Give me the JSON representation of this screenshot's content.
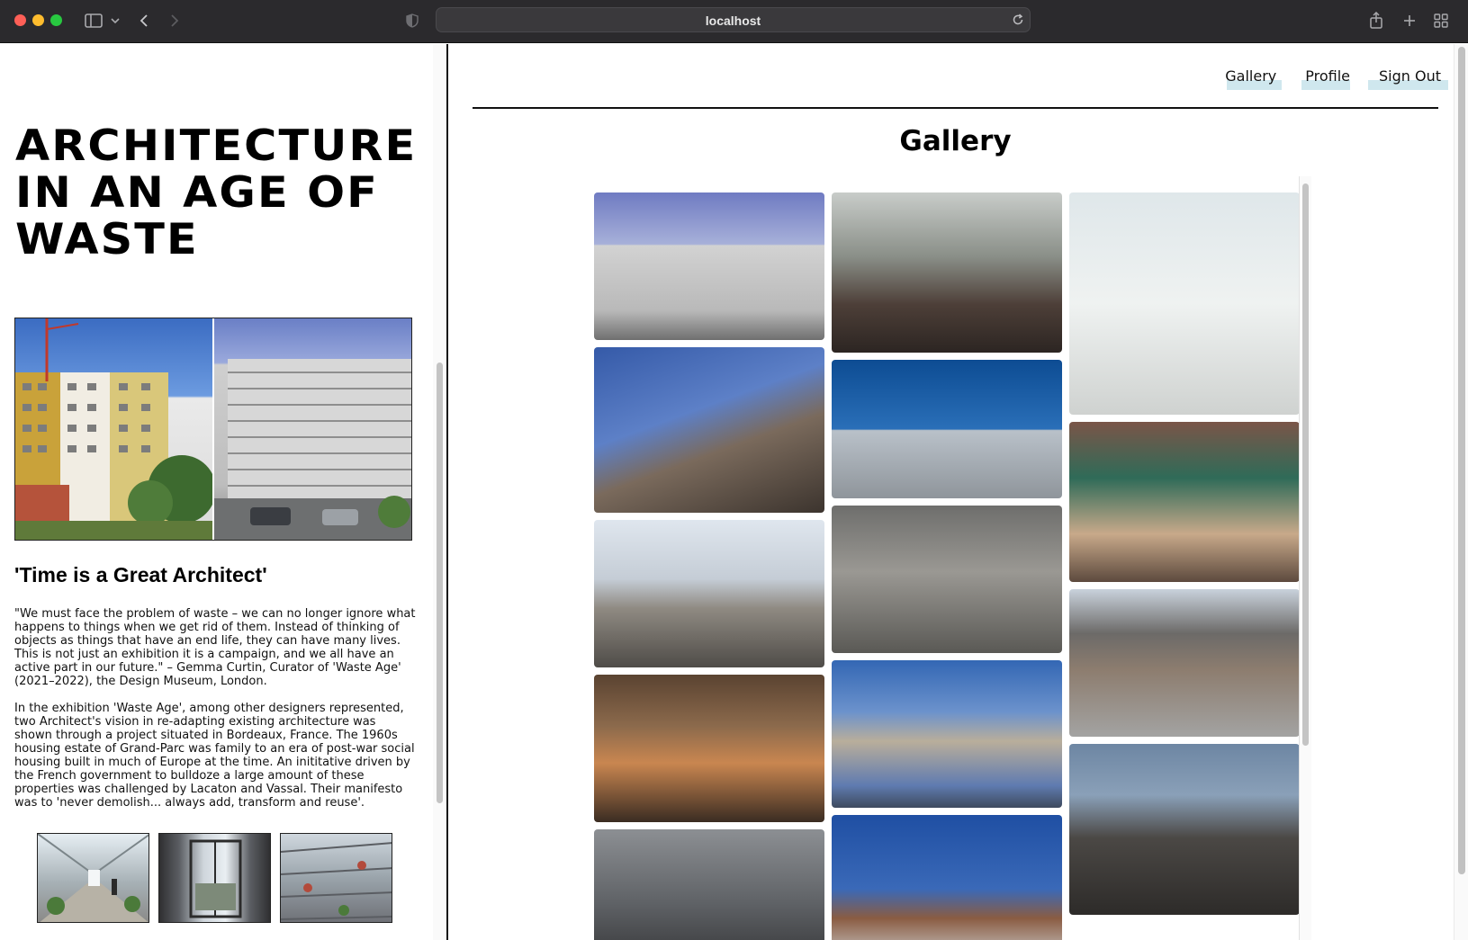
{
  "browser": {
    "url": "localhost"
  },
  "left": {
    "title_lines": [
      "ARCHITECTURE",
      "IN AN AGE OF",
      "WASTE"
    ],
    "hero_image_alt": "Grand-Parc housing before and after transformation",
    "quote_heading": "'Time is a Great Architect'",
    "paragraph1": "\"We must face the problem of waste – we can no longer ignore what happens to things when we get rid of them. Instead of thinking of objects as things that have an end life, they can have many lives. This is not just an exhibition it is a campaign, and we all have an active part in our future.\" – Gemma Curtin, Curator of 'Waste Age' (2021–2022), the Design Museum, London.",
    "paragraph2": "In the exhibition 'Waste Age', among other designers represented, two Architect's vision in re-adapting existing architecture was shown through a project situated in Bordeaux, France. The 1960s housing estate of Grand-Parc was family to an era of post-war social housing built in much of Europe at the time. An inititative driven by the French government to bulldoze a large amount of these properties was challenged by Lacaton and Vassal. Their manifesto was to 'never demolish... always add, transform and reuse'."
  },
  "nav": {
    "gallery": "Gallery",
    "profile": "Profile",
    "sign_out": "Sign Out"
  },
  "gallery": {
    "title": "Gallery",
    "columns": [
      [
        {
          "name": "housing-block-photo",
          "h": 164,
          "bg": "linear-gradient(180deg,#6f7bc2 0%,#a7b0d9 35%,#d2d2d2 36%,#b9b9b9 80%,#6f6f6f 100%)"
        },
        {
          "name": "barbican-tower-photo",
          "h": 184,
          "bg": "linear-gradient(160deg,#355aa8 0%,#5d80c7 40%,#7a6a5c 60%,#3c342e 100%)"
        },
        {
          "name": "silo-building-photo",
          "h": 164,
          "bg": "linear-gradient(180deg,#dfe6ee 0%,#c5cdd6 40%,#8f8a82 60%,#4f4c48 100%)"
        },
        {
          "name": "timber-roof-interior-photo",
          "h": 164,
          "bg": "linear-gradient(180deg,#5a4331 0%,#8c6a4c 35%,#c98650 60%,#3a2c22 100%)"
        },
        {
          "name": "industrial-site-photo",
          "h": 164,
          "bg": "linear-gradient(180deg,#8c8f93 0%,#5f6266 50%,#2e2e30 100%)"
        }
      ],
      [
        {
          "name": "arched-window-restaurant-photo",
          "h": 178,
          "bg": "linear-gradient(180deg,#c8ccc9 0%,#8a8f88 40%,#4d3f38 70%,#2c2522 100%)"
        },
        {
          "name": "cantilever-block-photo",
          "h": 154,
          "bg": "linear-gradient(180deg,#0d4c93 0%,#2a6fb8 50%,#b9c1c9 51%,#8f959b 100%)"
        },
        {
          "name": "concrete-hall-photo",
          "h": 164,
          "bg": "linear-gradient(180deg,#6e6e6c 0%,#9a9893 45%,#5a5955 100%)"
        },
        {
          "name": "brutalist-arches-photo",
          "h": 164,
          "bg": "linear-gradient(180deg,#3367b4 0%,#6c92cc 35%,#b9ae9b 55%,#5f7bb0 85%,#3e4a5e 100%)"
        },
        {
          "name": "tower-top-photo",
          "h": 164,
          "bg": "linear-gradient(180deg,#1f4fa3 0%,#3a69b8 50%,#8a5c42 70%,#cfd2d4 100%)"
        }
      ],
      [
        {
          "name": "glass-pavilion-photo",
          "h": 247,
          "bg": "linear-gradient(180deg,#dfe7ea 0%,#eff2f1 50%,#cfd2d0 100%)"
        },
        {
          "name": "green-market-hall-photo",
          "h": 178,
          "bg": "linear-gradient(180deg,#7a5548 0%,#2f6b58 35%,#c8a98a 70%,#5d4a3e 100%)"
        },
        {
          "name": "coal-drops-yard-photo",
          "h": 164,
          "bg": "linear-gradient(180deg,#c9d2dc 0%,#6c6a68 30%,#8d7d6f 55%,#a3a3a2 100%)"
        },
        {
          "name": "stone-ruin-church-photo",
          "h": 190,
          "bg": "linear-gradient(180deg,#6d86a3 0%,#8aa0b8 30%,#4b4845 55%,#2d2b29 100%)"
        }
      ]
    ]
  }
}
